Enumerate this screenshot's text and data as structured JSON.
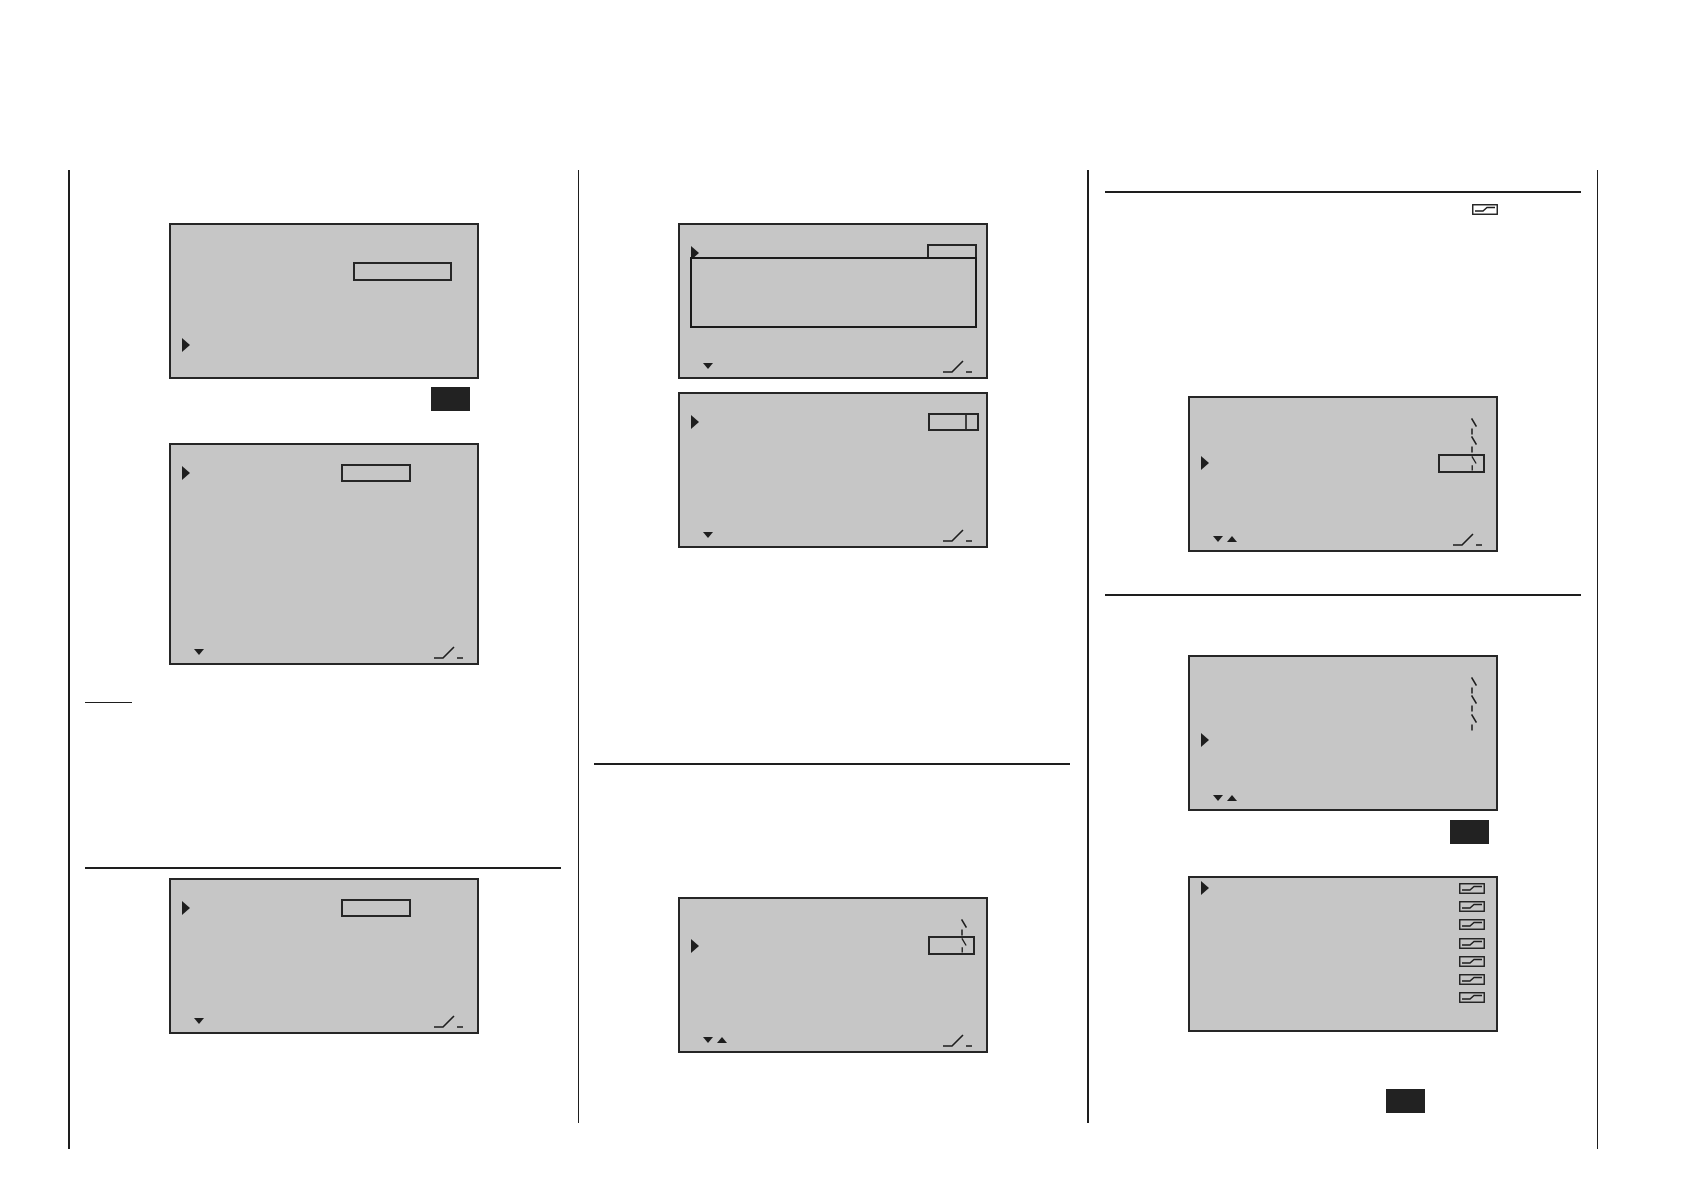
{
  "columns": [
    {
      "items": [
        {
          "kind": "screen",
          "rows": [
            {
              "kind": "blank",
              "cursor": false
            },
            {
              "kind": "blank",
              "cursor": false
            },
            {
              "kind": "long-field",
              "cursor": false
            },
            {
              "kind": "blank",
              "cursor": false
            },
            {
              "kind": "blank",
              "cursor": false
            },
            {
              "kind": "blank",
              "cursor": false
            },
            {
              "kind": "blank",
              "cursor": true
            }
          ],
          "scroll_down": false,
          "scroll_up": false,
          "switch_icon": false
        },
        {
          "kind": "key"
        },
        {
          "kind": "screen",
          "rows": [
            {
              "kind": "blank",
              "cursor": false
            },
            {
              "kind": "mid-field",
              "cursor": true
            }
          ],
          "scroll_down": true,
          "scroll_up": false,
          "switch_icon": true
        },
        {
          "kind": "underline"
        },
        {
          "kind": "rule"
        },
        {
          "kind": "screen",
          "rows": [
            {
              "kind": "blank",
              "cursor": false
            },
            {
              "kind": "mid-field",
              "cursor": true
            }
          ],
          "scroll_down": true,
          "scroll_up": false,
          "switch_icon": true
        }
      ]
    },
    {
      "items": [
        {
          "kind": "screen",
          "popup": true,
          "rows": [
            {
              "kind": "blank",
              "cursor": false
            },
            {
              "kind": "short-field",
              "cursor": true
            }
          ],
          "scroll_down": true,
          "scroll_up": false,
          "switch_icon": true
        },
        {
          "kind": "screen",
          "rows": [
            {
              "kind": "blank",
              "cursor": false
            },
            {
              "kind": "bar-field",
              "cursor": true
            }
          ],
          "scroll_down": true,
          "scroll_up": false,
          "switch_icon": true
        },
        {
          "kind": "rule"
        },
        {
          "kind": "screen",
          "rows": [
            {
              "kind": "blank",
              "cursor": false
            },
            {
              "kind": "switch",
              "cursor": false
            },
            {
              "kind": "switch-field",
              "cursor": true
            }
          ],
          "scroll_down": true,
          "scroll_up": true,
          "switch_icon": true
        }
      ]
    },
    {
      "items": [
        {
          "kind": "rule"
        },
        {
          "kind": "curve-icon"
        },
        {
          "kind": "screen",
          "rows": [
            {
              "kind": "blank",
              "cursor": false
            },
            {
              "kind": "switch",
              "cursor": false
            },
            {
              "kind": "switch",
              "cursor": false
            },
            {
              "kind": "switch-field",
              "cursor": true
            }
          ],
          "scroll_down": true,
          "scroll_up": true,
          "switch_icon": true
        },
        {
          "kind": "rule"
        },
        {
          "kind": "screen",
          "rows": [
            {
              "kind": "blank",
              "cursor": false
            },
            {
              "kind": "switch",
              "cursor": false
            },
            {
              "kind": "switch",
              "cursor": false
            },
            {
              "kind": "switch",
              "cursor": false
            },
            {
              "kind": "blank",
              "cursor": true
            }
          ],
          "scroll_down": true,
          "scroll_up": true,
          "switch_icon": false
        },
        {
          "kind": "key"
        },
        {
          "kind": "screen",
          "rows": [
            {
              "kind": "curve",
              "cursor": true
            },
            {
              "kind": "curve",
              "cursor": false
            },
            {
              "kind": "curve",
              "cursor": false
            },
            {
              "kind": "curve",
              "cursor": false
            },
            {
              "kind": "curve",
              "cursor": false
            },
            {
              "kind": "curve",
              "cursor": false
            },
            {
              "kind": "curve",
              "cursor": false
            }
          ],
          "scroll_down": false,
          "scroll_up": false,
          "switch_icon": false
        },
        {
          "kind": "key"
        }
      ]
    }
  ]
}
